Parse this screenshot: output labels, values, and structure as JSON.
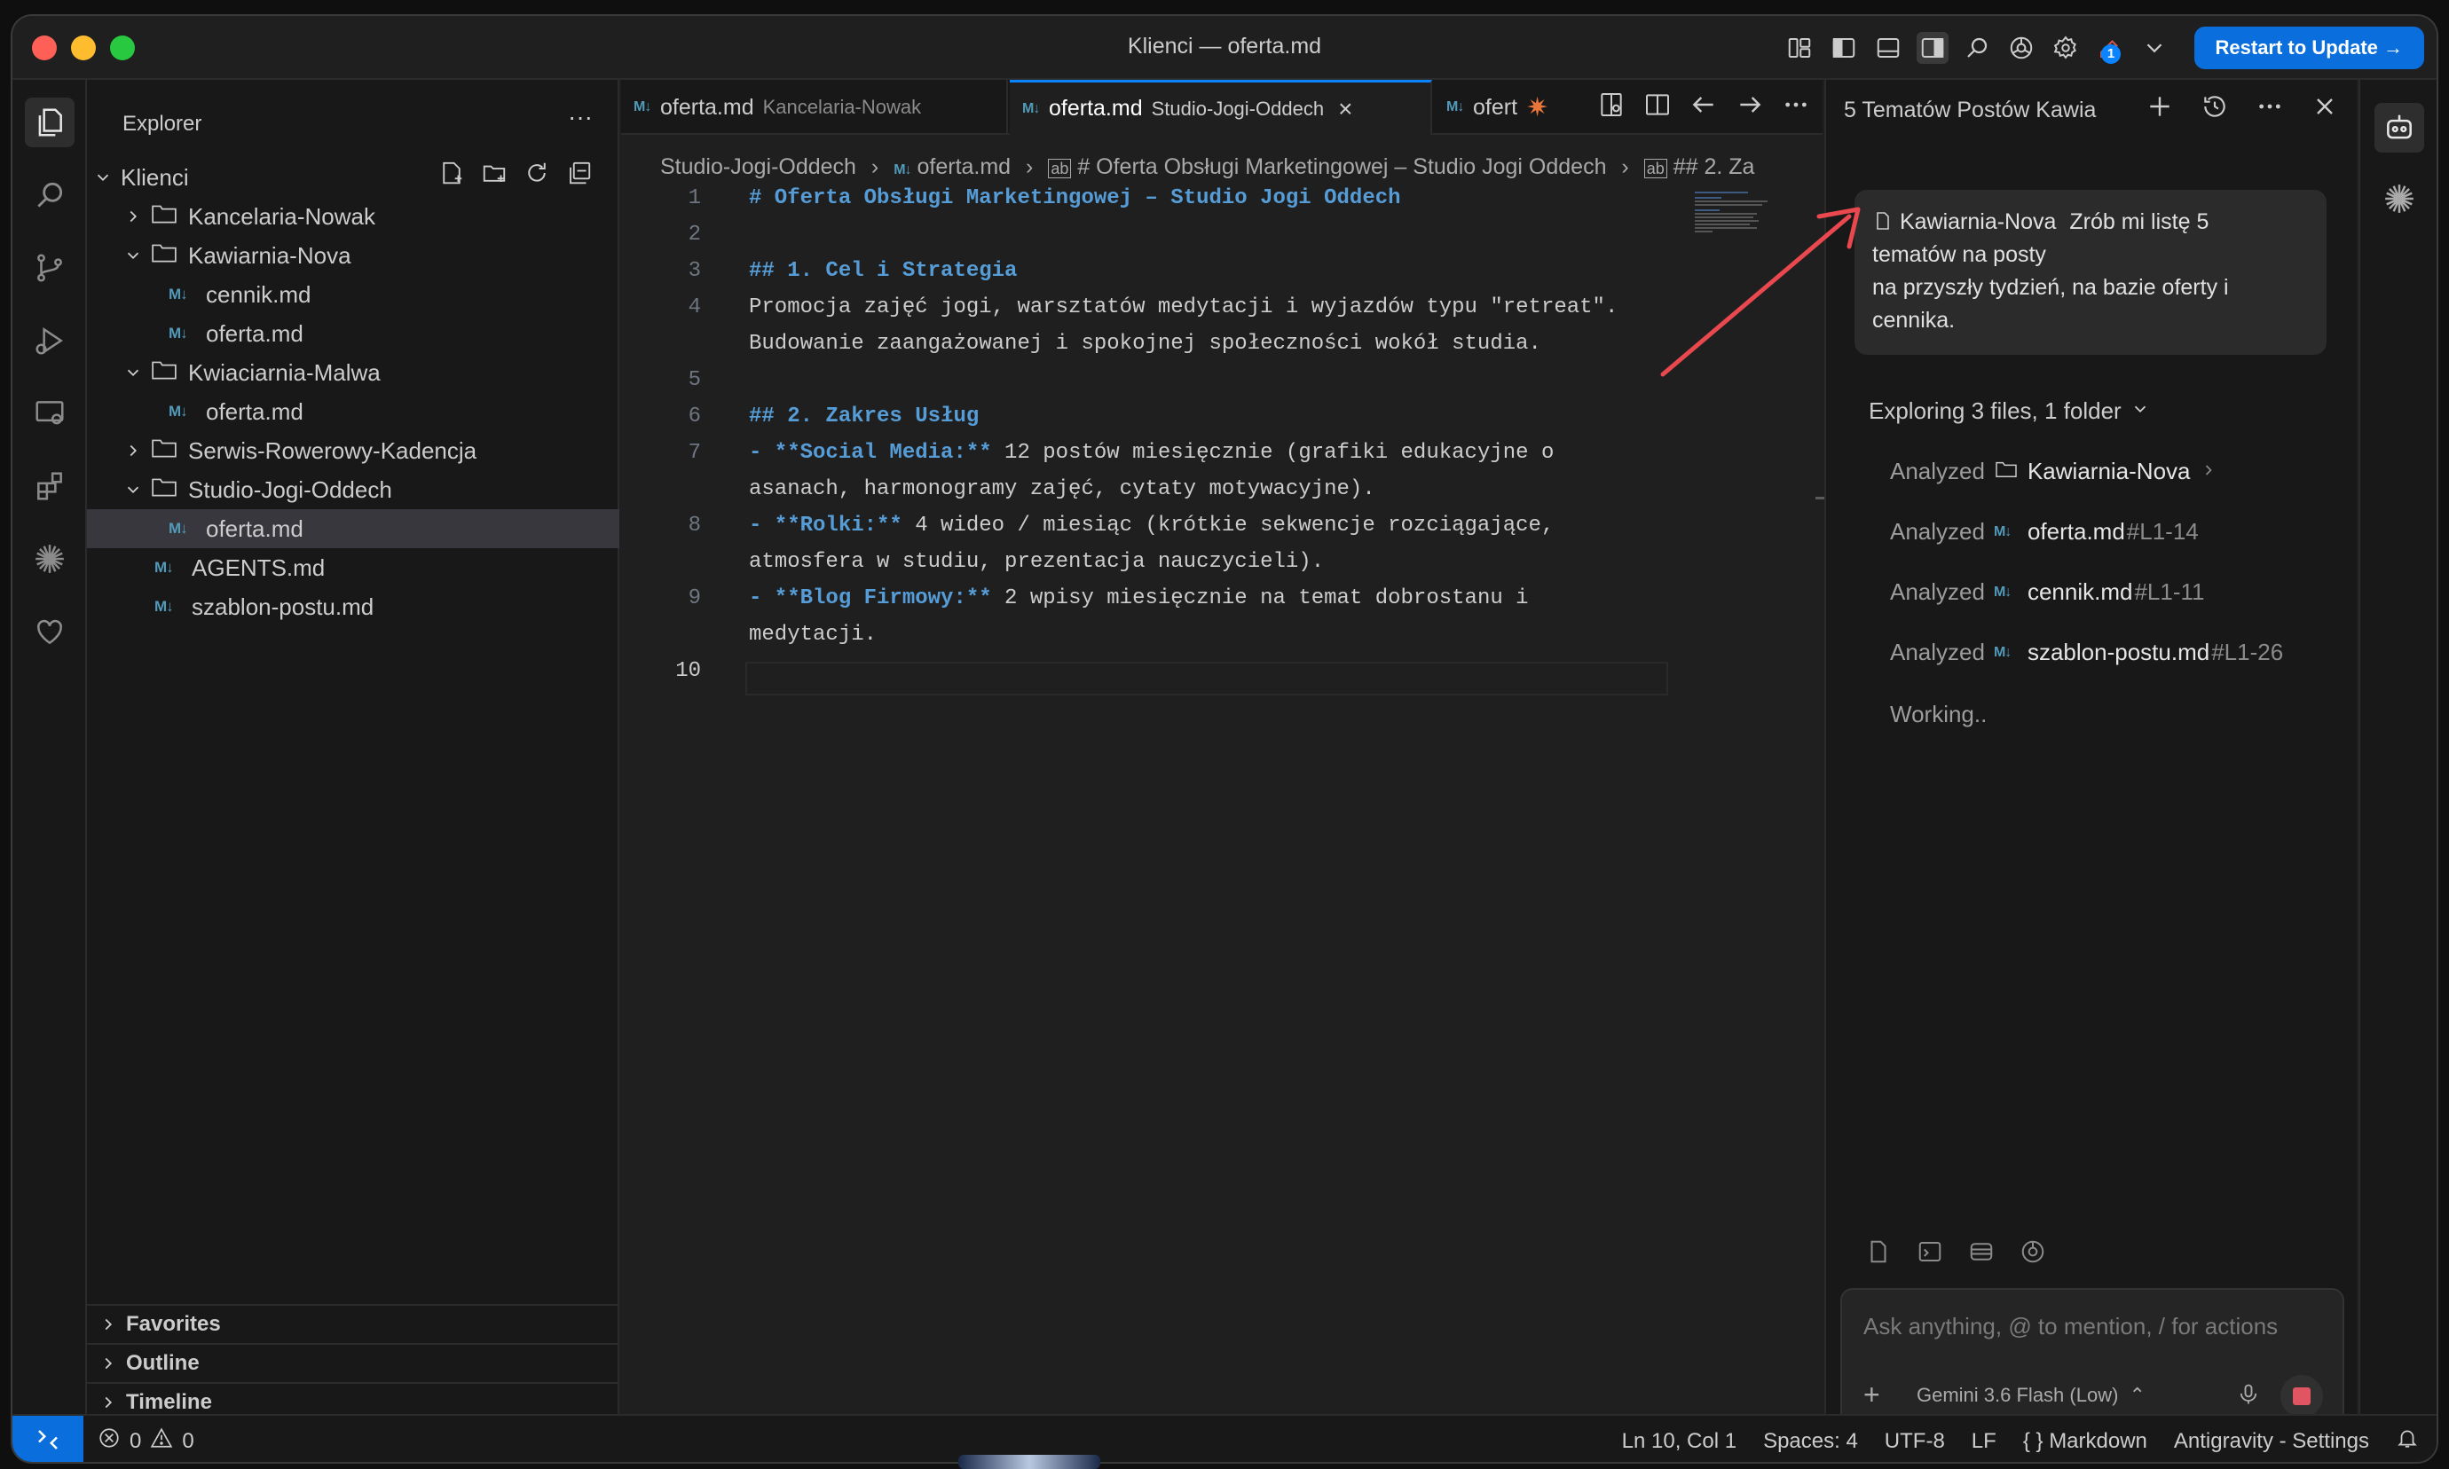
{
  "window": {
    "title": "Klienci — oferta.md",
    "restart_label": "Restart to Update →"
  },
  "explorer": {
    "header": "Explorer",
    "root": "Klienci",
    "items": [
      {
        "label": "Kancelaria-Nowak",
        "type": "folder",
        "open": false,
        "depth": 1
      },
      {
        "label": "Kawiarnia-Nova",
        "type": "folder",
        "open": true,
        "depth": 1
      },
      {
        "label": "cennik.md",
        "type": "file",
        "depth": 2
      },
      {
        "label": "oferta.md",
        "type": "file",
        "depth": 2
      },
      {
        "label": "Kwiaciarnia-Malwa",
        "type": "folder",
        "open": true,
        "depth": 1
      },
      {
        "label": "oferta.md",
        "type": "file",
        "depth": 2
      },
      {
        "label": "Serwis-Rowerowy-Kadencja",
        "type": "folder",
        "open": false,
        "depth": 1
      },
      {
        "label": "Studio-Jogi-Oddech",
        "type": "folder",
        "open": true,
        "depth": 1
      },
      {
        "label": "oferta.md",
        "type": "file",
        "depth": 2,
        "selected": true
      },
      {
        "label": "AGENTS.md",
        "type": "file",
        "depth": 1
      },
      {
        "label": "szablon-postu.md",
        "type": "file",
        "depth": 1
      }
    ],
    "sections": [
      "Favorites",
      "Outline",
      "Timeline"
    ]
  },
  "tabs": [
    {
      "label": "oferta.md",
      "desc": "Kancelaria-Nowak"
    },
    {
      "label": "oferta.md",
      "desc": "Studio-Jogi-Oddech",
      "active": true
    },
    {
      "label": "ofert"
    }
  ],
  "breadcrumb": {
    "folder": "Studio-Jogi-Oddech",
    "file": "oferta.md",
    "symbol1": "# Oferta Obsługi Marketingowej – Studio Jogi Oddech",
    "symbol2": "## 2. Za"
  },
  "code_lines": [
    {
      "n": "1",
      "text": "# Oferta Obsługi Marketingowej – Studio Jogi Oddech"
    },
    {
      "n": "2",
      "text": ""
    },
    {
      "n": "3",
      "text": "## 1. Cel i Strategia"
    },
    {
      "n": "4",
      "text": "Promocja zajęć jogi, warsztatów medytacji i wyjazdów typu \"retreat\"."
    },
    {
      "n": "",
      "text": "Budowanie zaangażowanej i spokojnej społeczności wokół studia."
    },
    {
      "n": "5",
      "text": ""
    },
    {
      "n": "6",
      "text": "## 2. Zakres Usług"
    },
    {
      "n": "7",
      "bold": "- **Social Media:**",
      "text": " 12 postów miesięcznie (grafiki edukacyjne o"
    },
    {
      "n": "",
      "text": "asanach, harmonogramy zajęć, cytaty motywacyjne)."
    },
    {
      "n": "8",
      "bold": "- **Rolki:**",
      "text": " 4 wideo / miesiąc (krótkie sekwencje rozciągające,"
    },
    {
      "n": "",
      "text": "atmosfera w studiu, prezentacja nauczycieli)."
    },
    {
      "n": "9",
      "bold": "- **Blog Firmowy:**",
      "text": " 2 wpisy miesięcznie na temat dobrostanu i"
    },
    {
      "n": "",
      "text": "medytacji."
    },
    {
      "n": "10",
      "text": ""
    }
  ],
  "chat": {
    "title": "5 Tematów Postów Kawia",
    "context_file": "Kawiarnia-Nova",
    "user_message_line1": "Zrób mi listę 5",
    "user_message_line2": "tematów na posty",
    "user_message_line3": "na przyszły tydzień, na bazie oferty i",
    "user_message_line4": "cennika.",
    "exploring": "Exploring 3 files, 1 folder",
    "analyzed": [
      {
        "label": "Analyzed",
        "name": "Kawiarnia-Nova",
        "range": "",
        "kind": "folder"
      },
      {
        "label": "Analyzed",
        "name": "oferta.md",
        "range": "#L1-14",
        "kind": "file"
      },
      {
        "label": "Analyzed",
        "name": "cennik.md",
        "range": "#L1-11",
        "kind": "file"
      },
      {
        "label": "Analyzed",
        "name": "szablon-postu.md",
        "range": "#L1-26",
        "kind": "file"
      }
    ],
    "working": "Working..",
    "input_placeholder": "Ask anything, @ to mention, / for actions",
    "model": "Gemini 3.6 Flash (Low)"
  },
  "status": {
    "errors": "0",
    "warnings": "0",
    "position": "Ln 10, Col 1",
    "spaces": "Spaces: 4",
    "encoding": "UTF-8",
    "eol": "LF",
    "language": "Markdown",
    "settings": "Antigravity - Settings"
  },
  "colors": {
    "accent": "#0a6fdc",
    "heading": "#569cd6",
    "arrow": "#e8484e"
  }
}
